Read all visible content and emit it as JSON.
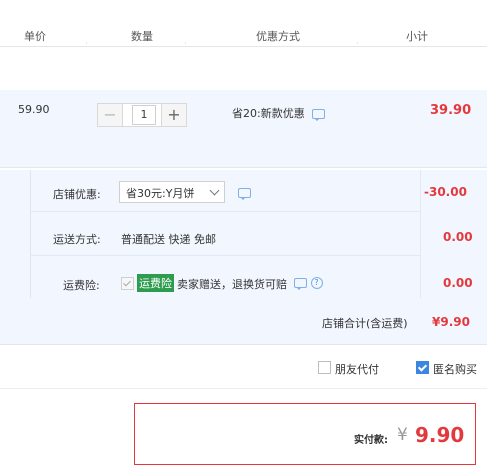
{
  "table_header": {
    "unit_price": "单价",
    "quantity": "数量",
    "promotion": "优惠方式",
    "subtotal": "小计"
  },
  "item": {
    "price": "59.90",
    "qty_minus": "−",
    "qty_value": "1",
    "qty_plus": "+",
    "promotion": "省20:新款优惠",
    "subtotal": "39.90"
  },
  "shop": {
    "discount_label": "店铺优惠:",
    "discount_select": "省30元:Y月饼",
    "discount_value": "-30.00",
    "shipping_label": "运送方式:",
    "shipping_method": "普通配送 快递 免邮",
    "shipping_value": "0.00",
    "insurance_label": "运费险:",
    "insurance_tag": "运费险",
    "insurance_text": "卖家赠送，退换货可赔",
    "insurance_value": "0.00",
    "total_label": "店铺合计(含运费)",
    "total_value": "¥9.90"
  },
  "options": {
    "friend_pay": "朋友代付",
    "anonymous": "匿名购买"
  },
  "payment": {
    "label": "实付款:",
    "currency": "¥",
    "amount": "9.90"
  },
  "colors": {
    "accent_red": "#e4393c",
    "tag_green": "#2e9c4f",
    "checkbox_blue": "#3b86e0",
    "row_bg": "#f2f7ff"
  }
}
